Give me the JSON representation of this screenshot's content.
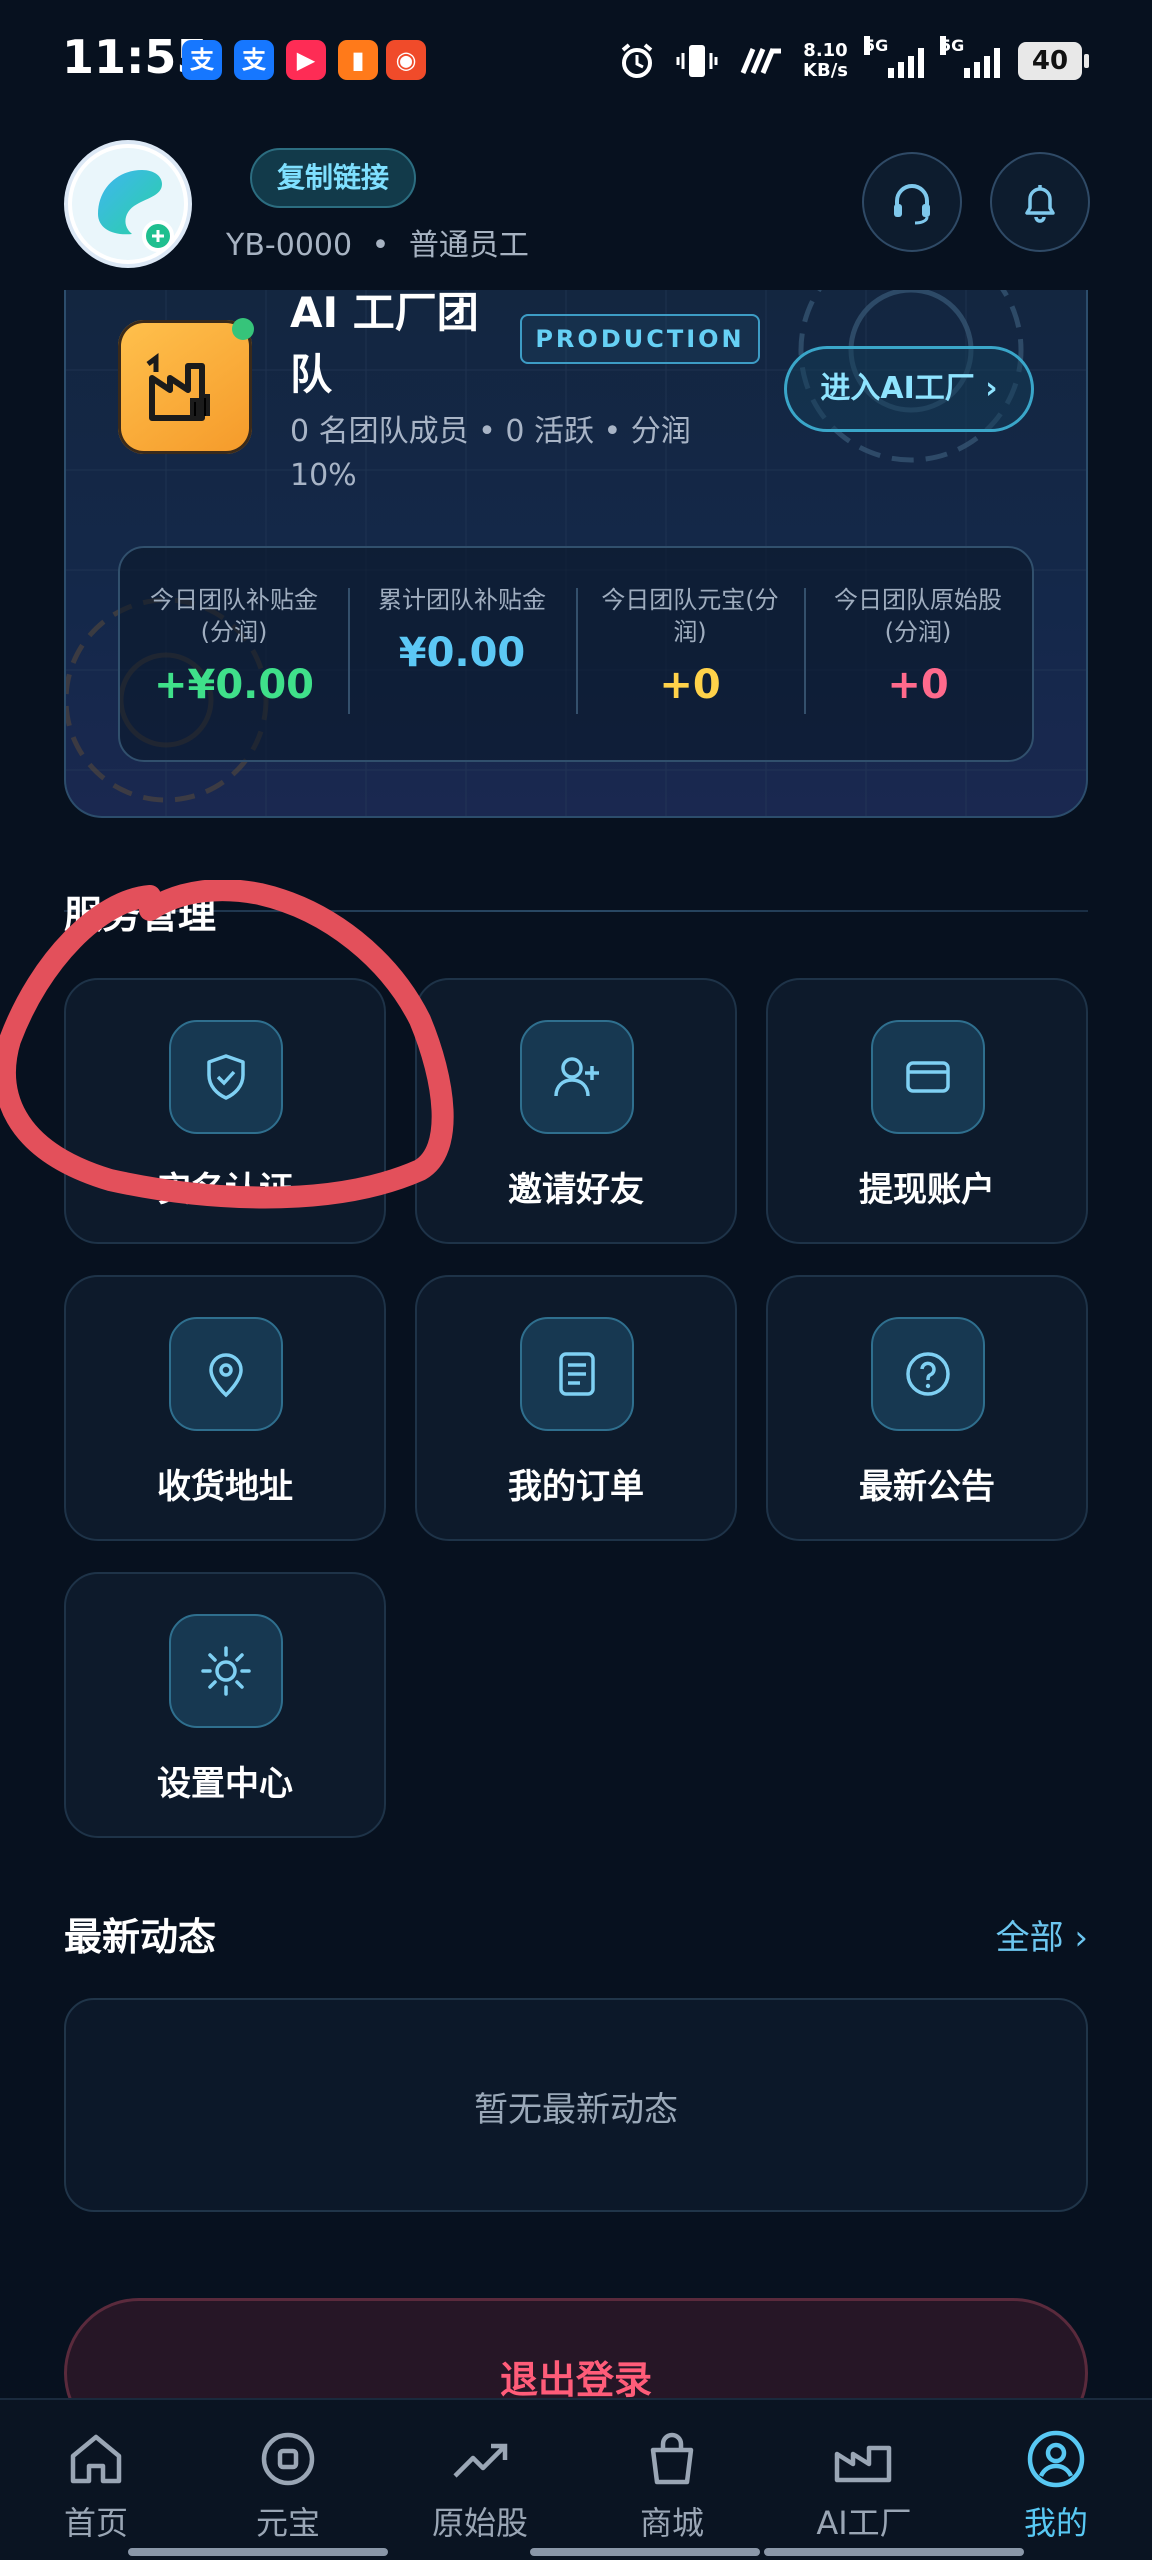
{
  "status_bar": {
    "time": "11:55",
    "apps": [
      "支",
      "支",
      "",
      "",
      ""
    ],
    "net_speed_value": "8.10",
    "net_speed_unit": "KB/s",
    "sim1": "5G",
    "sim2": "5G",
    "battery": "40"
  },
  "profile": {
    "copy_link": "复制链接",
    "user_id": "YB-0000",
    "separator": "•",
    "role": "普通员工"
  },
  "team": {
    "title": "AI 工厂团队",
    "badge": "PRODUCTION",
    "enter_button": "进入AI工厂 ›",
    "subtitle": "0 名团队成员 • 0 活跃 • 分润 10%",
    "stats": [
      {
        "label": "今日团队补贴金(分润)",
        "value": "+¥0.00",
        "color": "#3fe08a"
      },
      {
        "label": "累计团队补贴金",
        "value": "¥0.00",
        "color": "#5cc8f5"
      },
      {
        "label": "今日团队元宝(分润)",
        "value": "+0",
        "color": "#ffd24a"
      },
      {
        "label": "今日团队原始股(分润)",
        "value": "+0",
        "color": "#ff6a8c"
      }
    ]
  },
  "services": {
    "title": "服务管理",
    "items": [
      {
        "label": "实名认证",
        "icon": "shield-check-icon"
      },
      {
        "label": "邀请好友",
        "icon": "user-plus-icon"
      },
      {
        "label": "提现账户",
        "icon": "credit-card-icon"
      },
      {
        "label": "收货地址",
        "icon": "map-pin-icon"
      },
      {
        "label": "我的订单",
        "icon": "document-icon"
      },
      {
        "label": "最新公告",
        "icon": "help-circle-icon"
      },
      {
        "label": "设置中心",
        "icon": "sun-gear-icon"
      }
    ]
  },
  "news": {
    "title": "最新动态",
    "all": "全部 ›",
    "empty": "暂无最新动态"
  },
  "logout": "退出登录",
  "nav": [
    {
      "label": "首页",
      "icon": "home-icon"
    },
    {
      "label": "元宝",
      "icon": "coin-icon"
    },
    {
      "label": "原始股",
      "icon": "trend-up-icon"
    },
    {
      "label": "商城",
      "icon": "shopping-bag-icon"
    },
    {
      "label": "AI工厂",
      "icon": "factory-icon"
    },
    {
      "label": "我的",
      "icon": "user-circle-icon",
      "active": true
    }
  ]
}
